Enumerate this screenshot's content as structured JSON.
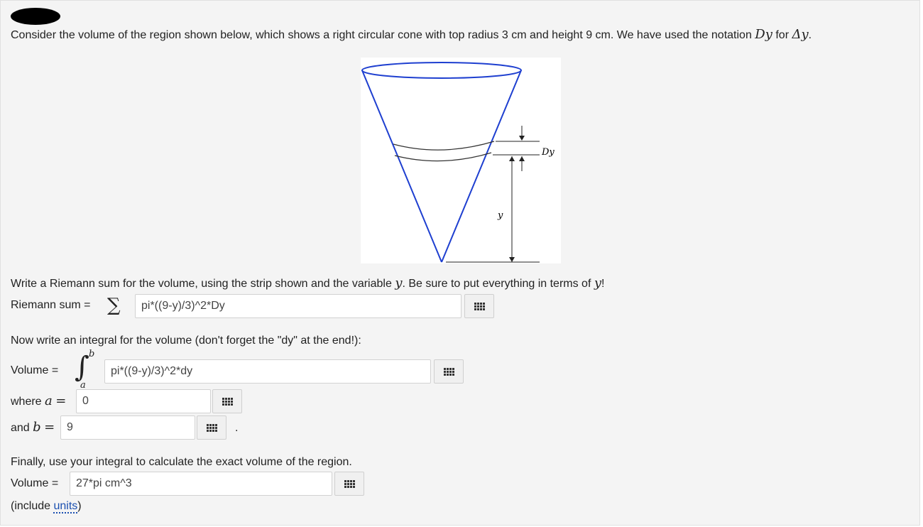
{
  "intro": {
    "text": "Consider the volume of the region shown below, which shows a right circular cone with top radius 3 cm and height 9 cm. We have used the notation",
    "notation_var": "Dy",
    "for_word": "for",
    "delta_var": "Δy",
    "period": "."
  },
  "figure": {
    "label_dy": "Dy",
    "label_y": "y"
  },
  "q1": {
    "prompt_start": "Write a Riemann sum for the volume, using the strip shown and the variable",
    "var": "y",
    "prompt_mid": ". Be sure to put everything in terms of",
    "var2": "y",
    "prompt_end": "!",
    "label": "Riemann sum =",
    "sigma": "∑",
    "answer": "pi*((9-y)/3)^2*Dy"
  },
  "q2": {
    "prompt": "Now write an integral for the volume (don't forget the \"dy\" at the end!):",
    "label": "Volume =",
    "integral_sign": "∫",
    "upper": "b",
    "lower": "a",
    "answer": "pi*((9-y)/3)^2*dy",
    "where_label": "where",
    "a_var": "a",
    "eq": "=",
    "a_value": "0",
    "and_label": "and",
    "b_var": "b",
    "b_value": "9",
    "trailing_period": "."
  },
  "q3": {
    "prompt": "Finally, use your integral to calculate the exact volume of the region.",
    "label": "Volume =",
    "answer": "27*pi cm^3",
    "include_open": "(include ",
    "units_link": "units",
    "include_close": ")"
  },
  "icons": {
    "keypad": "equation-editor-grid-icon"
  }
}
